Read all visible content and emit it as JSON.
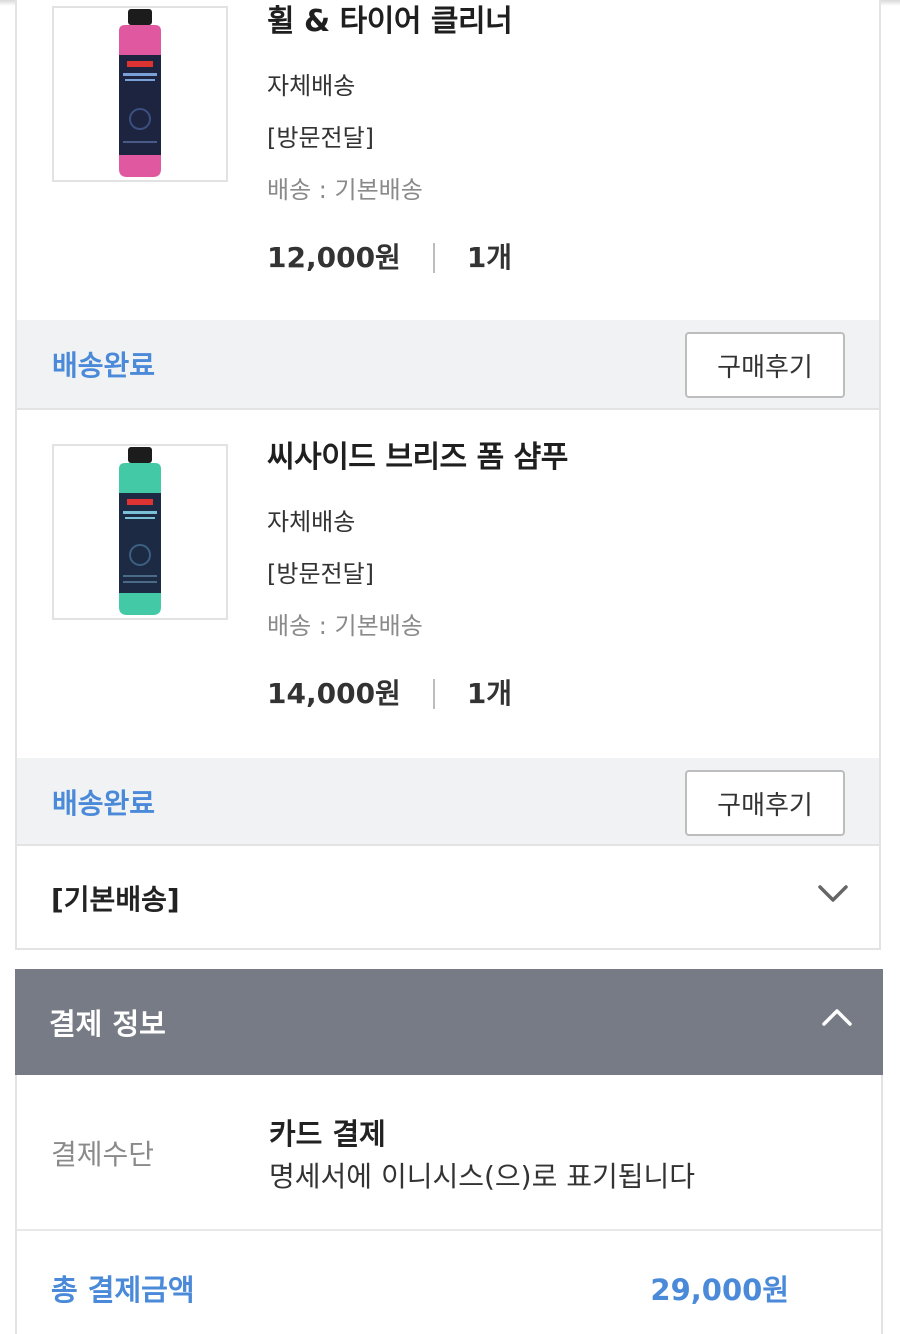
{
  "products": [
    {
      "name": "휠 & 타이어 클리너",
      "delivery_type": "자체배송",
      "delivery_method": "[방문전달]",
      "shipping": "배송 : 기본배송",
      "price": "12,000원",
      "quantity": "1개",
      "status": "배송완료",
      "review_button": "구매후기",
      "bottle_color": "#e0589f"
    },
    {
      "name": "씨사이드 브리즈 폼 샴푸",
      "delivery_type": "자체배송",
      "delivery_method": "[방문전달]",
      "shipping": "배송 : 기본배송",
      "price": "14,000원",
      "quantity": "1개",
      "status": "배송완료",
      "review_button": "구매후기",
      "bottle_color": "#43c9a6"
    }
  ],
  "shipping_group": {
    "label": "[기본배송]",
    "icon": "chevron-down-icon"
  },
  "payment": {
    "title": "결제 정보",
    "icon": "chevron-up-icon",
    "method_label": "결제수단",
    "method_value": "카드 결제",
    "method_note": "명세서에 이니시스(으)로 표기됩니다",
    "total_label": "총 결제금액",
    "total_value": "29,000원"
  },
  "colors": {
    "accent_blue": "#4a8ad9",
    "header_gray": "#777b85",
    "status_bg": "#f1f2f4"
  }
}
